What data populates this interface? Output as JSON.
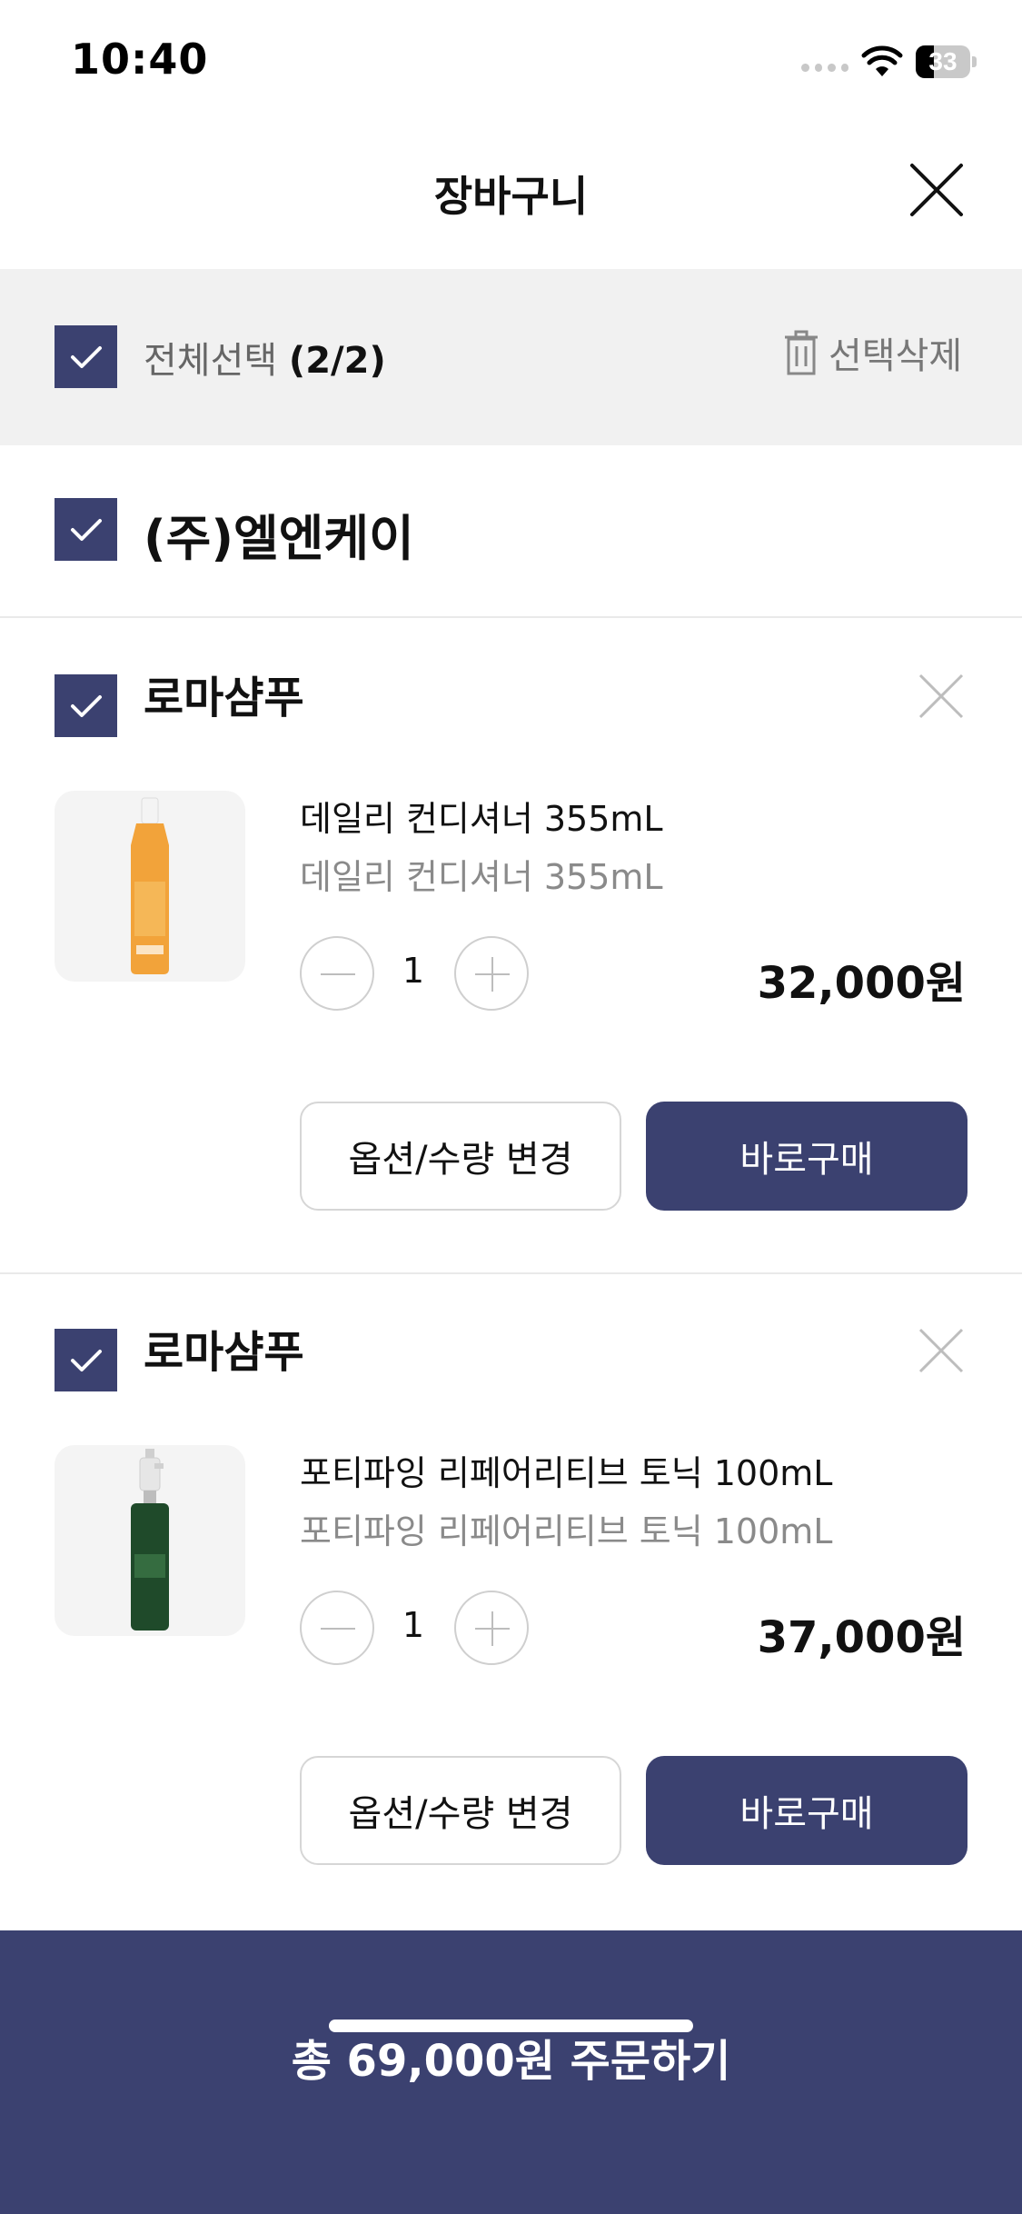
{
  "status_bar": {
    "time": "10:40",
    "battery": "33",
    "battery_level": 0.33
  },
  "header": {
    "title": "장바구니"
  },
  "select_bar": {
    "label": "전체선택",
    "count": "(2/2)",
    "delete_label": "선택삭제"
  },
  "store": {
    "name": "(주)엘엔케이"
  },
  "items": [
    {
      "brand": "로마샴푸",
      "product": "데일리 컨디셔너 355mL",
      "option": "데일리 컨디셔너 355mL",
      "quantity": "1",
      "price": "32,000원",
      "option_button": "옵션/수량 변경",
      "buy_button": "바로구매",
      "thumb_color": "#f2a33a"
    },
    {
      "brand": "로마샴푸",
      "product": "포티파잉 리페어리티브 토닉 100mL",
      "option": "포티파잉 리페어리티브 토닉 100mL",
      "quantity": "1",
      "price": "37,000원",
      "option_button": "옵션/수량 변경",
      "buy_button": "바로구매",
      "thumb_color": "#1f4a2a"
    }
  ],
  "order": {
    "label": "총 69,000원 주문하기"
  },
  "colors": {
    "accent": "#3b4170",
    "background_bar": "#f1f1f1"
  }
}
